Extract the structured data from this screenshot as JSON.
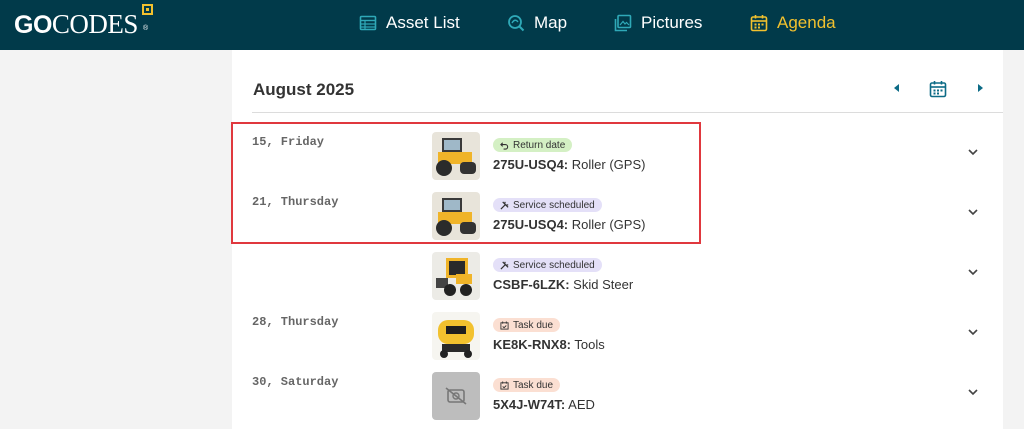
{
  "brand": {
    "go": "GO",
    "codes": "CODES",
    "reg": "®"
  },
  "nav": [
    {
      "label": "Asset List",
      "icon": "table-icon",
      "active": false
    },
    {
      "label": "Map",
      "icon": "map-search-icon",
      "active": false
    },
    {
      "label": "Pictures",
      "icon": "gallery-icon",
      "active": false
    },
    {
      "label": "Agenda",
      "icon": "calendar-icon",
      "active": true
    }
  ],
  "agenda": {
    "month": "August 2025",
    "events": [
      {
        "day": "15, Friday",
        "badge": "Return date",
        "badge_icon": "return-icon",
        "badge_color": "#d4f0c4",
        "asset_id": "275U-USQ4:",
        "asset_name": "Roller (GPS)",
        "thumb": "roller"
      },
      {
        "day": "21, Thursday",
        "badge": "Service scheduled",
        "badge_icon": "wrench-icon",
        "badge_color": "#e4e0f8",
        "asset_id": "275U-USQ4:",
        "asset_name": "Roller (GPS)",
        "thumb": "roller"
      },
      {
        "day": "",
        "badge": "Service scheduled",
        "badge_icon": "wrench-icon",
        "badge_color": "#e4e0f8",
        "asset_id": "CSBF-6LZK:",
        "asset_name": "Skid Steer",
        "thumb": "skid-steer"
      },
      {
        "day": "28, Thursday",
        "badge": "Task due",
        "badge_icon": "task-icon",
        "badge_color": "#fbdfd2",
        "asset_id": "KE8K-RNX8:",
        "asset_name": "Tools",
        "thumb": "compressor"
      },
      {
        "day": "30, Saturday",
        "badge": "Task due",
        "badge_icon": "task-icon",
        "badge_color": "#fbdfd2",
        "asset_id": "5X4J-W74T:",
        "asset_name": "AED",
        "thumb": "no-image"
      }
    ]
  },
  "colors": {
    "topbar": "#013a4a",
    "accent": "#f2c12e",
    "nav_icon": "#2fa9b8",
    "highlight": "#e0383e"
  }
}
